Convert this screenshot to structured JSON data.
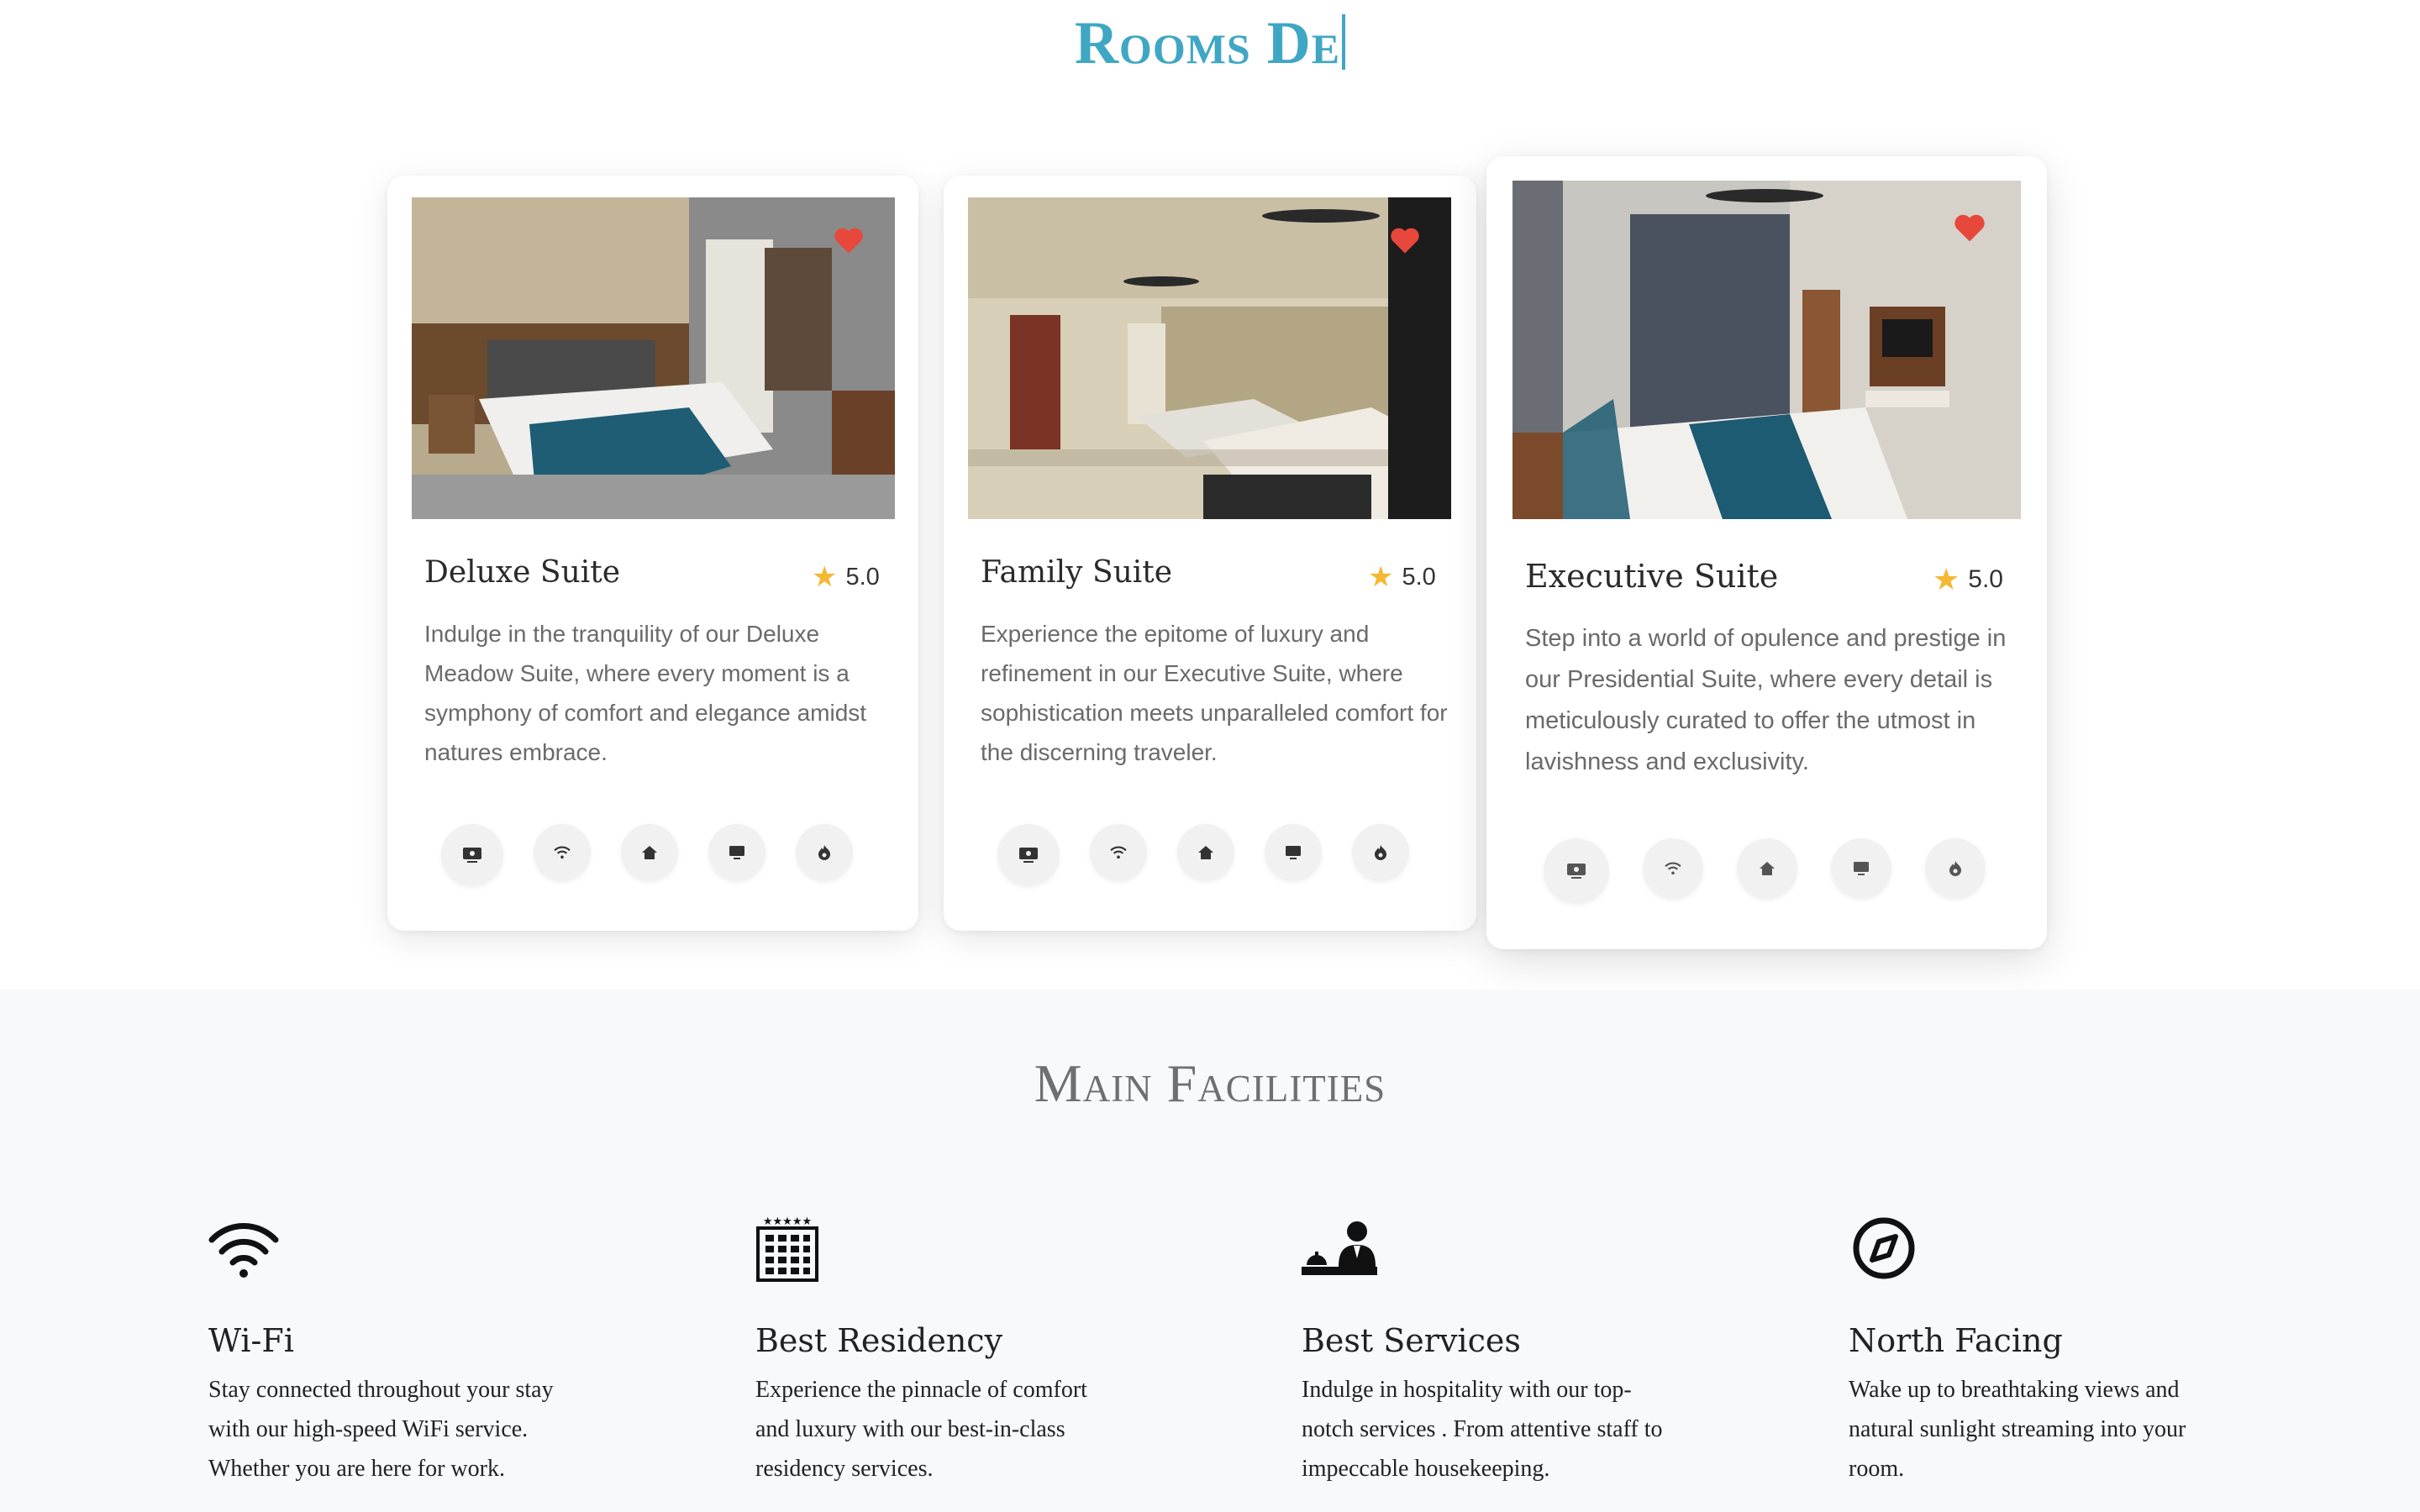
{
  "rooms_section": {
    "title": "Rooms De",
    "cards": [
      {
        "name": "Deluxe Suite",
        "rating": "5.0",
        "description": "Indulge in the tranquility of our Deluxe Meadow Suite, where every moment is a symphony of comfort and elegance amidst natures embrace.",
        "amenity_icons": [
          "tv-icon",
          "wifi-icon",
          "home-icon",
          "monitor-icon",
          "fire-icon"
        ]
      },
      {
        "name": "Family Suite",
        "rating": "5.0",
        "description": "Experience the epitome of luxury and refinement in our Executive Suite, where sophistication meets unparalleled comfort for the discerning traveler.",
        "amenity_icons": [
          "tv-icon",
          "wifi-icon",
          "home-icon",
          "monitor-icon",
          "fire-icon"
        ]
      },
      {
        "name": "Executive Suite",
        "rating": "5.0",
        "description": "Step into a world of opulence and prestige in our Presidential Suite, where every detail is meticulously curated to offer the utmost in lavishness and exclusivity.",
        "amenity_icons": [
          "tv-icon",
          "wifi-icon",
          "home-icon",
          "monitor-icon",
          "fire-icon"
        ]
      }
    ]
  },
  "facilities_section": {
    "title": "Main Facilities",
    "items": [
      {
        "icon": "wifi-icon",
        "name": "Wi-Fi",
        "description": "Stay connected throughout your stay with our high-speed WiFi service. Whether you are here for work."
      },
      {
        "icon": "hotel-building-icon",
        "name": "Best Residency",
        "description": "Experience the pinnacle of comfort and luxury with our best-in-class residency services."
      },
      {
        "icon": "concierge-icon",
        "name": "Best Services",
        "description": "Indulge in hospitality with our top-notch services . From attentive staff to impeccable housekeeping."
      },
      {
        "icon": "compass-icon",
        "name": "North Facing",
        "description": "Wake up to breathtaking views and natural sunlight streaming into your room."
      }
    ]
  },
  "colors": {
    "title_accent": "#3fa7c4",
    "heart": "#e8473c",
    "star": "#f4b833",
    "facilities_bg": "#f7f9fa"
  }
}
